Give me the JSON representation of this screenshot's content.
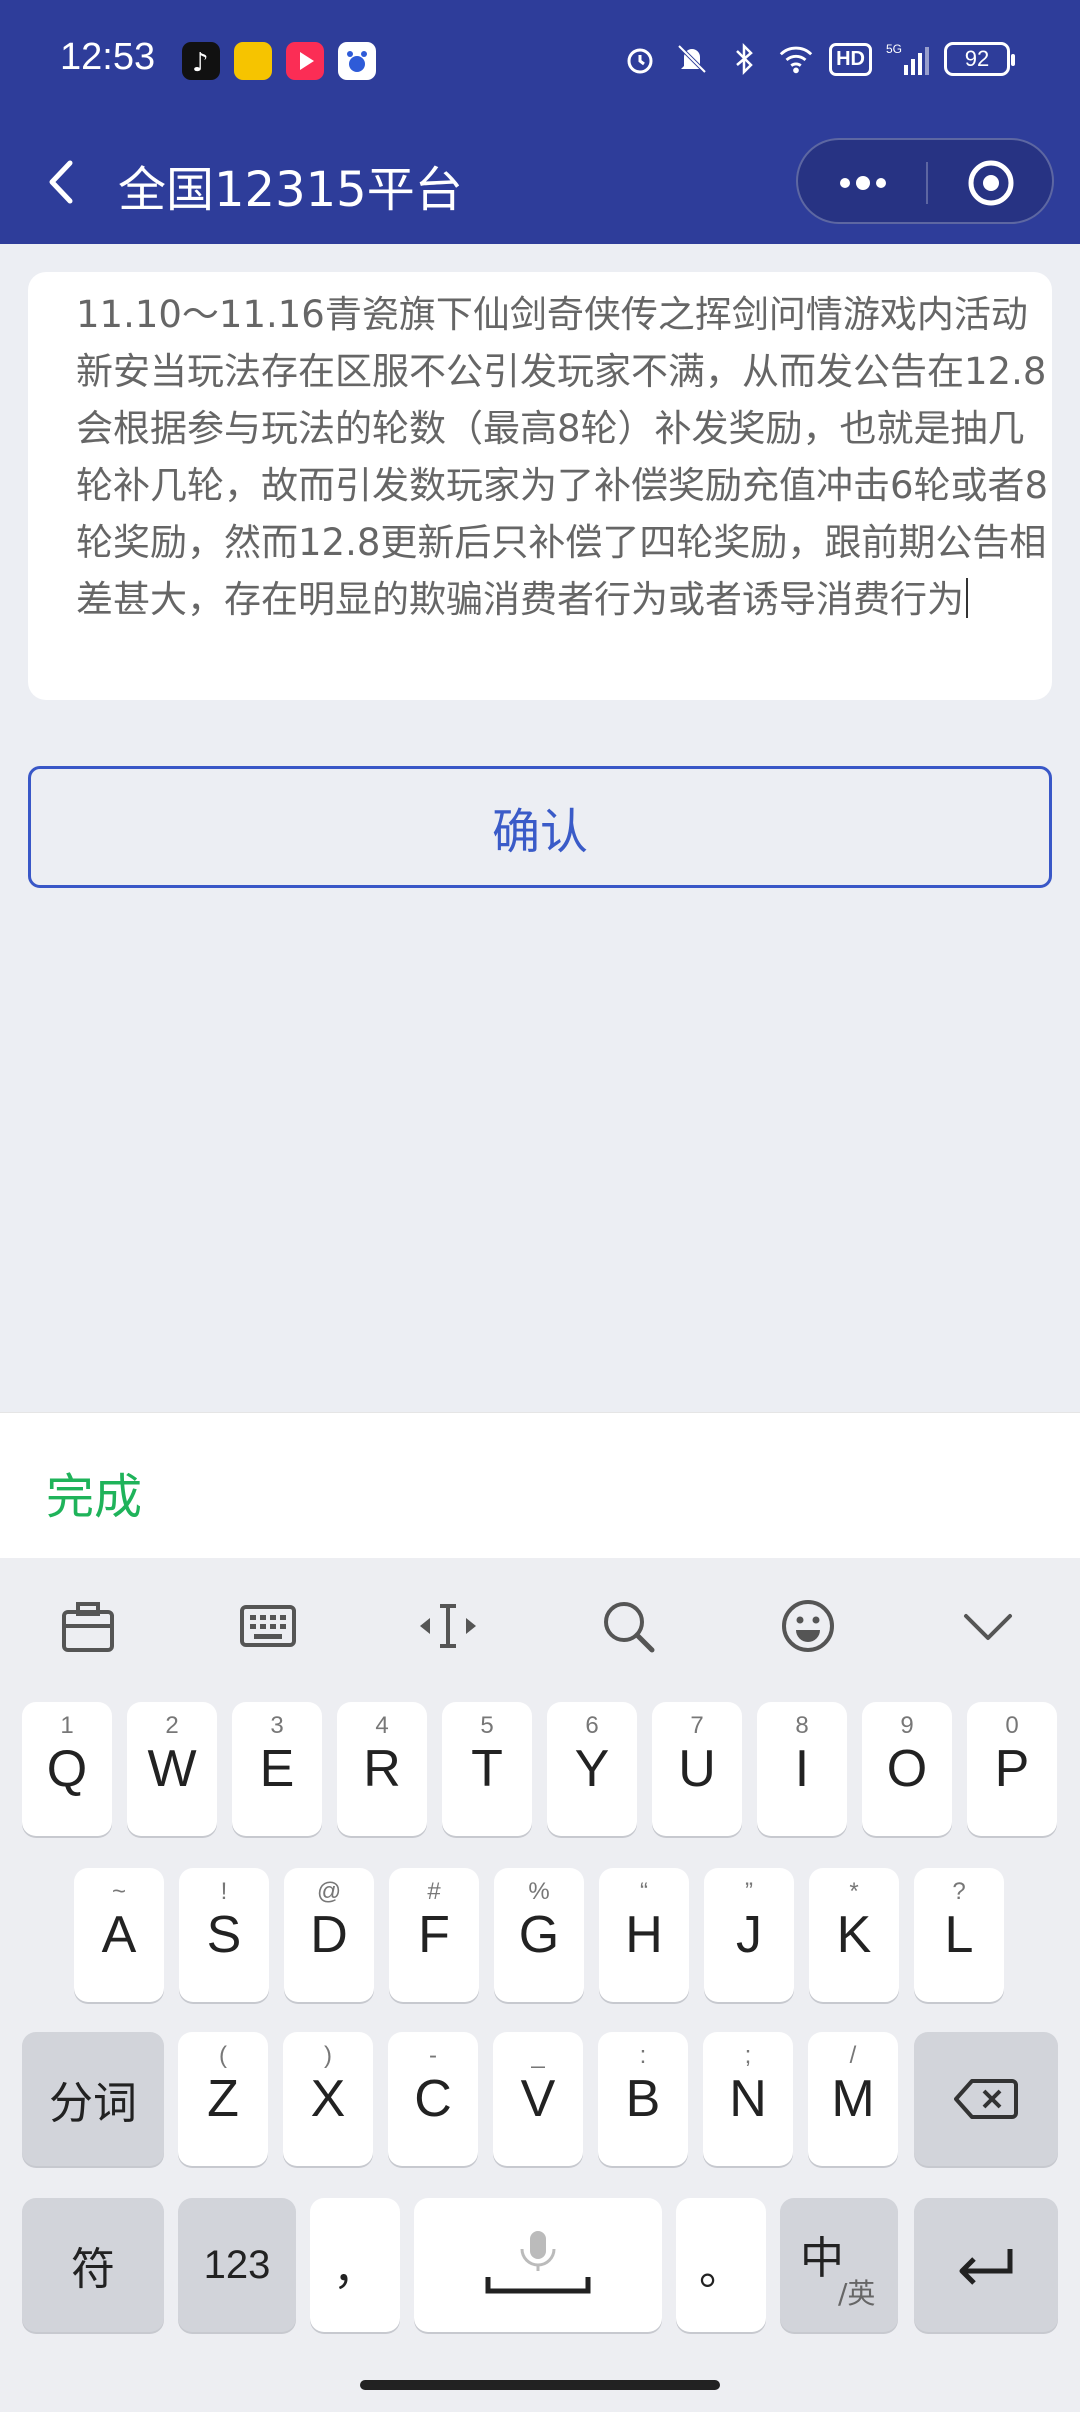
{
  "status_bar": {
    "time": "12:53",
    "battery": "92",
    "hd": "HD",
    "network": "5G"
  },
  "header": {
    "title": "全国12315平台"
  },
  "complaint": {
    "text": "11.10～11.16青瓷旗下仙剑奇侠传之挥剑问情游戏内活动新安当玩法存在区服不公引发玩家不满，从而发公告在12.8会根据参与玩法的轮数（最高8轮）补发奖励，也就是抽几轮补几轮，故而引发数玩家为了补偿奖励充值冲击6轮或者8轮奖励，然而12.8更新后只补偿了四轮奖励，跟前期公告相差甚大，存在明显的欺骗消费者行为或者诱导消费行为"
  },
  "confirm_label": "确认",
  "done_label": "完成",
  "keyboard": {
    "row1": [
      {
        "k": "Q",
        "s": "1"
      },
      {
        "k": "W",
        "s": "2"
      },
      {
        "k": "E",
        "s": "3"
      },
      {
        "k": "R",
        "s": "4"
      },
      {
        "k": "T",
        "s": "5"
      },
      {
        "k": "Y",
        "s": "6"
      },
      {
        "k": "U",
        "s": "7"
      },
      {
        "k": "I",
        "s": "8"
      },
      {
        "k": "O",
        "s": "9"
      },
      {
        "k": "P",
        "s": "0"
      }
    ],
    "row2": [
      {
        "k": "A",
        "s": "~"
      },
      {
        "k": "S",
        "s": "!"
      },
      {
        "k": "D",
        "s": "@"
      },
      {
        "k": "F",
        "s": "#"
      },
      {
        "k": "G",
        "s": "%"
      },
      {
        "k": "H",
        "s": "“"
      },
      {
        "k": "J",
        "s": "”"
      },
      {
        "k": "K",
        "s": "*"
      },
      {
        "k": "L",
        "s": "?"
      }
    ],
    "row3": [
      {
        "k": "Z",
        "s": "("
      },
      {
        "k": "X",
        "s": ")"
      },
      {
        "k": "C",
        "s": "-"
      },
      {
        "k": "V",
        "s": "_"
      },
      {
        "k": "B",
        "s": ":"
      },
      {
        "k": "N",
        "s": ";"
      },
      {
        "k": "M",
        "s": "/"
      }
    ],
    "segment_label": "分词",
    "symbol_label": "符",
    "numeric_label": "123",
    "comma_label": "，",
    "period_label": "。",
    "lang_main": "中",
    "lang_sub": "/英"
  },
  "colors": {
    "header_bg": "#2e3d9a",
    "confirm_border": "#3957c7",
    "done_color": "#1fb35a"
  }
}
